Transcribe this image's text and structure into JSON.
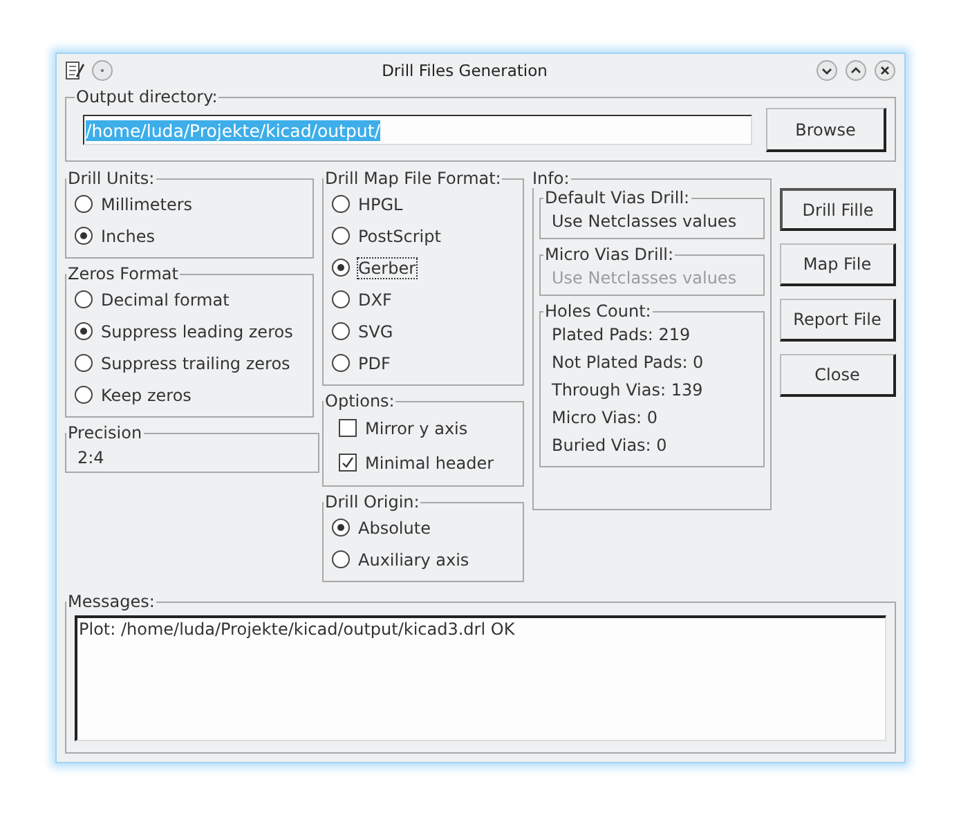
{
  "window": {
    "title": "Drill Files Generation"
  },
  "output_directory": {
    "legend": "Output directory:",
    "value": "/home/luda/Projekte/kicad/output/",
    "browse": "Browse"
  },
  "drill_units": {
    "legend": "Drill Units:",
    "options": [
      {
        "label": "Millimeters",
        "selected": false
      },
      {
        "label": "Inches",
        "selected": true
      }
    ]
  },
  "zeros_format": {
    "legend": "Zeros Format",
    "options": [
      {
        "label": "Decimal format",
        "selected": false
      },
      {
        "label": "Suppress leading zeros",
        "selected": true
      },
      {
        "label": "Suppress trailing zeros",
        "selected": false
      },
      {
        "label": "Keep zeros",
        "selected": false
      }
    ]
  },
  "precision": {
    "legend": "Precision",
    "value": "2:4"
  },
  "drill_map_format": {
    "legend": "Drill Map File Format:",
    "options": [
      {
        "label": "HPGL",
        "selected": false
      },
      {
        "label": "PostScript",
        "selected": false
      },
      {
        "label": "Gerber",
        "selected": true
      },
      {
        "label": "DXF",
        "selected": false
      },
      {
        "label": "SVG",
        "selected": false
      },
      {
        "label": "PDF",
        "selected": false
      }
    ]
  },
  "options": {
    "legend": "Options:",
    "items": [
      {
        "label": "Mirror y axis",
        "checked": false
      },
      {
        "label": "Minimal header",
        "checked": true
      }
    ]
  },
  "drill_origin": {
    "legend": "Drill Origin:",
    "options": [
      {
        "label": "Absolute",
        "selected": true
      },
      {
        "label": "Auxiliary axis",
        "selected": false
      }
    ]
  },
  "info": {
    "legend": "Info:",
    "fields": [
      {
        "legend": "Default Vias Drill:",
        "value": "Use Netclasses values",
        "disabled": false
      },
      {
        "legend": "Micro Vias Drill:",
        "value": "Use Netclasses values",
        "disabled": true
      }
    ],
    "holes_count": {
      "legend": "Holes Count:",
      "lines": [
        "Plated Pads: 219",
        "Not Plated Pads: 0",
        "Through Vias: 139",
        "Micro Vias: 0",
        "Buried Vias: 0"
      ]
    }
  },
  "buttons": [
    {
      "label": "Drill Fille",
      "default": true
    },
    {
      "label": "Map File",
      "default": false
    },
    {
      "label": "Report File",
      "default": false
    },
    {
      "label": "Close",
      "default": false
    }
  ],
  "messages": {
    "legend": "Messages:",
    "text": "Plot: /home/luda/Projekte/kicad/output/kicad3.drl OK"
  }
}
